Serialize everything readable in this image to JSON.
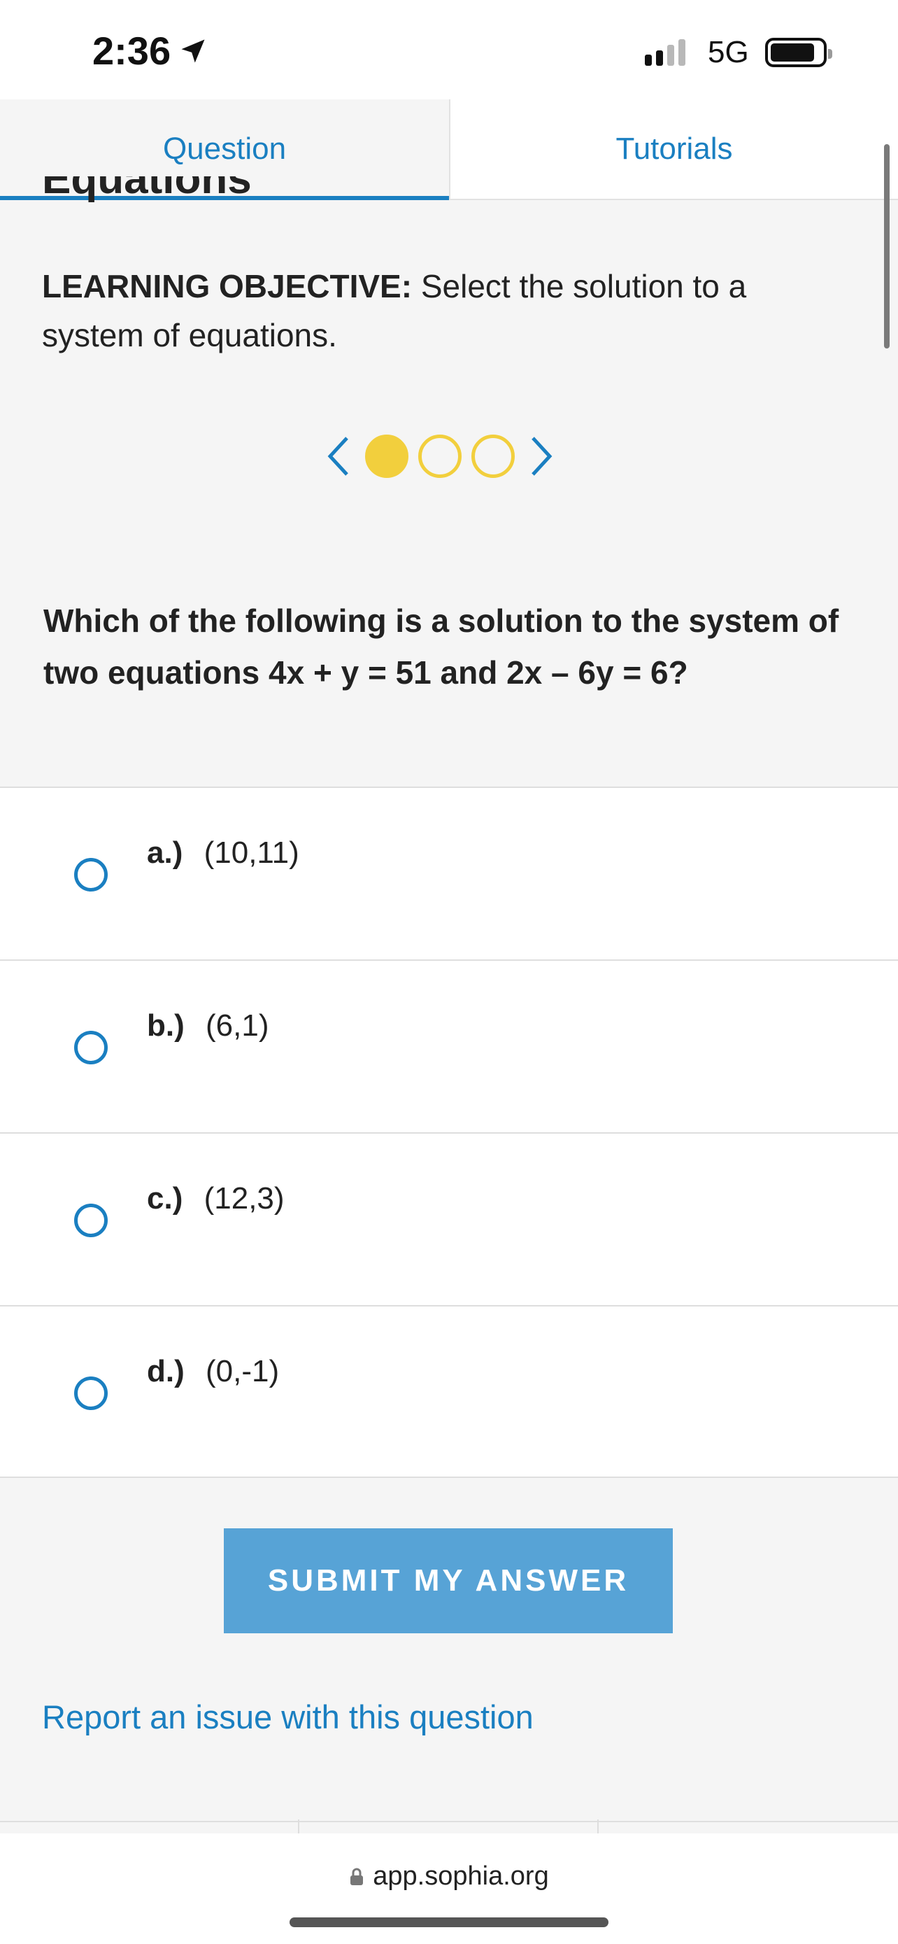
{
  "status": {
    "time": "2:36",
    "network": "5G"
  },
  "tabs": [
    {
      "label": "Question",
      "active": true
    },
    {
      "label": "Tutorials",
      "active": false
    }
  ],
  "partial_heading": "Equations",
  "objective": {
    "label": "LEARNING OBJECTIVE:",
    "text": "Select the solution to a system of equations."
  },
  "pager": {
    "total": 3,
    "current": 1
  },
  "question": "Which of the following is a solution to the system of two equations 4x + y = 51 and 2x – 6y = 6?",
  "options": [
    {
      "letter": "a.)",
      "value": "(10,11)"
    },
    {
      "letter": "b.)",
      "value": "(6,1)"
    },
    {
      "letter": "c.)",
      "value": "(12,3)"
    },
    {
      "letter": "d.)",
      "value": "(0,-1)"
    }
  ],
  "submit_label": "SUBMIT MY ANSWER",
  "report_label": "Report an issue with this question",
  "browser": {
    "url": "app.sophia.org"
  },
  "colors": {
    "accent": "#1a7fc1",
    "dot": "#f2cf3d",
    "submit": "#57a3d6"
  }
}
